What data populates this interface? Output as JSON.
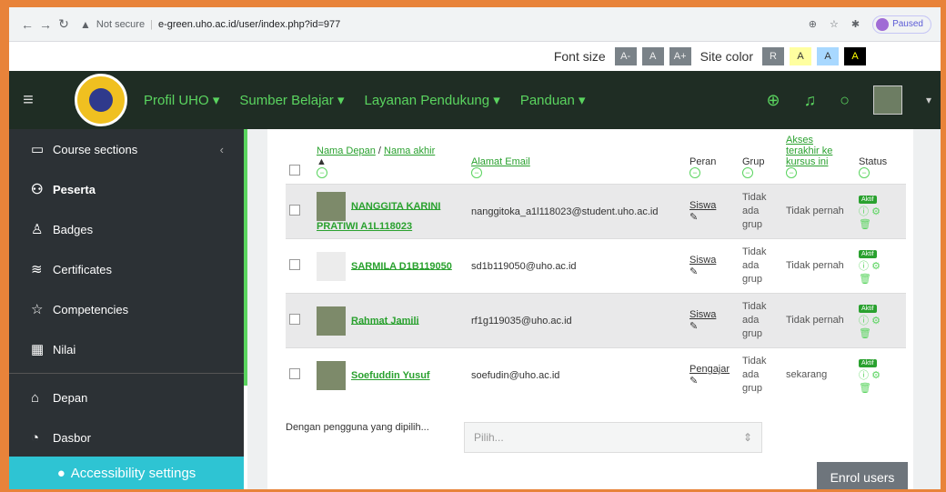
{
  "browser": {
    "url_warning": "Not secure",
    "url": "e-green.uho.ac.id/user/index.php?id=977",
    "profile_status": "Paused"
  },
  "accessibility": {
    "font_size_label": "Font size",
    "font_buttons": [
      "A-",
      "A",
      "A+"
    ],
    "site_color_label": "Site color",
    "color_buttons": [
      "R",
      "A",
      "A",
      "A"
    ]
  },
  "nav": {
    "items": [
      "Profil UHO",
      "Sumber Belajar",
      "Layanan Pendukung",
      "Panduan"
    ]
  },
  "sidebar": {
    "items": [
      {
        "label": "Course sections",
        "icon": "folder-icon"
      },
      {
        "label": "Peserta",
        "icon": "users-icon"
      },
      {
        "label": "Badges",
        "icon": "badge-icon"
      },
      {
        "label": "Certificates",
        "icon": "certificate-icon"
      },
      {
        "label": "Competencies",
        "icon": "star-icon"
      },
      {
        "label": "Nilai",
        "icon": "grades-icon"
      },
      {
        "label": "Depan",
        "icon": "home-icon"
      },
      {
        "label": "Dasbor",
        "icon": "dashboard-icon"
      }
    ],
    "accessibility_settings": "Accessibility settings"
  },
  "table": {
    "headers": {
      "first_name": "Nama Depan",
      "separator": "/",
      "last_name": "Nama akhir",
      "email": "Alamat Email",
      "role": "Peran",
      "group": "Grup",
      "last_access": "Akses terakhir ke kursus ini",
      "status": "Status"
    },
    "rows": [
      {
        "name": "NANGGITA KARINI PRATIWI A1L118023",
        "email": "nanggitoka_a1l118023@student.uho.ac.id",
        "role": "Siswa",
        "group": "Tidak ada grup",
        "access": "Tidak pernah",
        "status": "Aktif"
      },
      {
        "name": "SARMILA D1B119050",
        "email": "sd1b119050@uho.ac.id",
        "role": "Siswa",
        "group": "Tidak ada grup",
        "access": "Tidak pernah",
        "status": "Aktif"
      },
      {
        "name": "Rahmat Jamili",
        "email": "rf1g119035@uho.ac.id",
        "role": "Siswa",
        "group": "Tidak ada grup",
        "access": "Tidak pernah",
        "status": "Aktif"
      },
      {
        "name": "Soefuddin Yusuf",
        "email": "soefudin@uho.ac.id",
        "role": "Pengajar",
        "group": "Tidak ada grup",
        "access": "sekarang",
        "status": "Aktif"
      }
    ]
  },
  "bulk": {
    "label": "Dengan pengguna yang dipilih...",
    "placeholder": "Pilih..."
  },
  "enrol_button": "Enrol users"
}
